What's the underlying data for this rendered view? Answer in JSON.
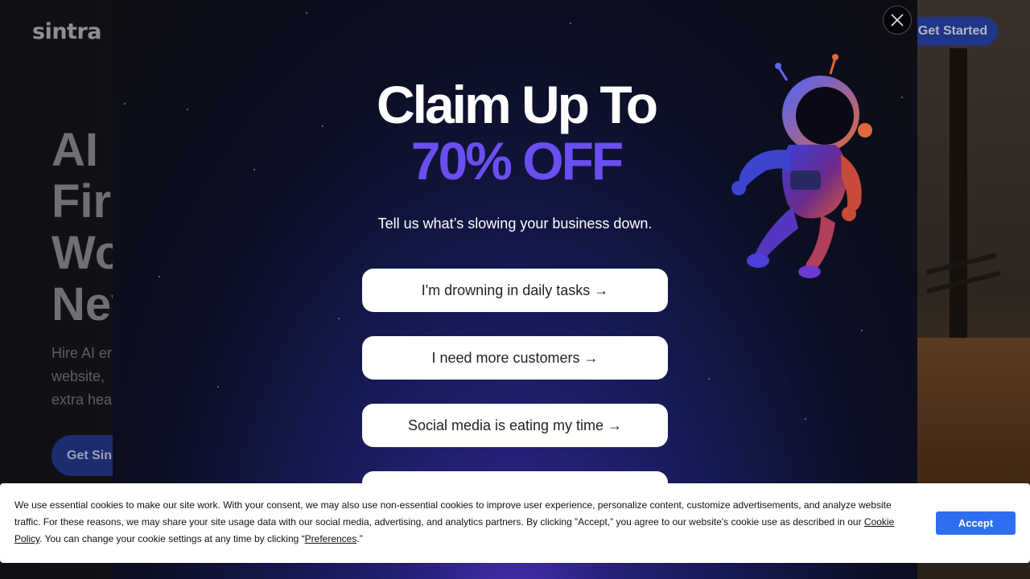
{
  "header": {
    "logo_text": "sintra",
    "cta_label": "Get Started"
  },
  "hero": {
    "title_lines": [
      "AI I",
      "Firs",
      "Wo",
      "Nev"
    ],
    "subtitle_lines": [
      "Hire AI er",
      "website,",
      "extra hea"
    ],
    "cta_label": "Get Sin"
  },
  "modal": {
    "headline_line1": "Claim Up To",
    "headline_line2": "70% OFF",
    "subtitle": "Tell us what’s slowing your business down.",
    "options": [
      {
        "label": "I'm drowning in daily tasks →"
      },
      {
        "label": "I need more customers →"
      },
      {
        "label": "Social media is eating my time →"
      }
    ],
    "close_icon": "close-icon",
    "accent_color": "#6a4ff0"
  },
  "cookie_banner": {
    "text_part1": "We use essential cookies to make our site work. With your consent, we may also use non-essential cookies to improve user experience, personalize content, customize advertisements, and analyze website traffic. For these reasons, we may share your site usage data with our social media, advertising, and analytics partners. By clicking ”Accept,” you agree to our website's cookie use as described in our ",
    "cookie_policy_link": "Cookie Policy",
    "text_part2": ". You can change your cookie settings at any time by clicking “",
    "preferences_link": "Preferences",
    "text_part3": ".”",
    "accept_label": "Accept",
    "accept_color": "#2f6ef0"
  }
}
